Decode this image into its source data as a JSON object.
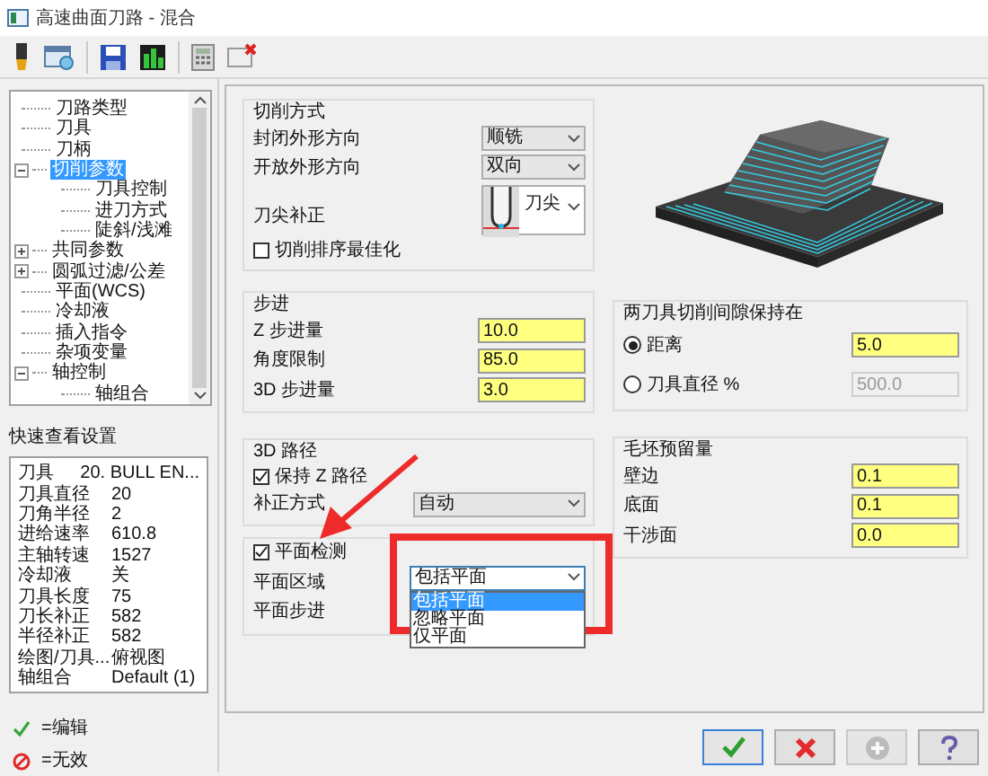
{
  "window": {
    "title": "高速曲面刀路 - 混合"
  },
  "tree": [
    {
      "label": "刀路类型",
      "selected": false
    },
    {
      "label": "刀具",
      "selected": false
    },
    {
      "label": "刀柄",
      "selected": false
    },
    {
      "label": "切削参数",
      "selected": true,
      "expanded": true,
      "children": [
        {
          "label": "刀具控制",
          "selected": false
        },
        {
          "label": "进刀方式",
          "selected": false
        },
        {
          "label": "陡斜/浅滩",
          "selected": false
        }
      ]
    },
    {
      "label": "共同参数",
      "selected": false,
      "expanded": false
    },
    {
      "label": "圆弧过滤/公差",
      "selected": false,
      "expanded": false
    },
    {
      "label": "平面(WCS)",
      "selected": false
    },
    {
      "label": "冷却液",
      "selected": false
    },
    {
      "label": "插入指令",
      "selected": false
    },
    {
      "label": "杂项变量",
      "selected": false
    },
    {
      "label": "轴控制",
      "selected": false,
      "expanded": true,
      "children": [
        {
          "label": "轴组合",
          "selected": false
        }
      ]
    }
  ],
  "quick_view": {
    "title": "快速查看设置",
    "rows": [
      {
        "label": "刀具",
        "value": "20. BULL EN..."
      },
      {
        "label": "刀具直径",
        "value": "20"
      },
      {
        "label": "刀角半径",
        "value": "2"
      },
      {
        "label": "进给速率",
        "value": "610.8"
      },
      {
        "label": "主轴转速",
        "value": "1527"
      },
      {
        "label": "冷却液",
        "value": "关"
      },
      {
        "label": "刀具长度",
        "value": "75"
      },
      {
        "label": "刀长补正",
        "value": "582"
      },
      {
        "label": "半径补正",
        "value": "582"
      },
      {
        "label": "绘图/刀具...",
        "value": "俯视图"
      },
      {
        "label": "轴组合",
        "value": "Default (1)"
      }
    ]
  },
  "legend": [
    {
      "kind": "edit",
      "text": "=编辑"
    },
    {
      "kind": "invalid",
      "text": "=无效"
    }
  ],
  "cut_method": {
    "title": "切削方式",
    "fields": [
      {
        "kind": "select",
        "label": "封闭外形方向",
        "value": "顺铣"
      },
      {
        "kind": "select",
        "label": "开放外形方向",
        "value": "双向"
      },
      {
        "kind": "tool",
        "label": "刀尖补正",
        "value": "刀尖"
      },
      {
        "kind": "checkbox",
        "label": "切削排序最佳化",
        "checked": false
      }
    ]
  },
  "stepdown": {
    "title": "步进",
    "fields": [
      {
        "kind": "input",
        "label": "Z 步进量",
        "value": "10.0"
      },
      {
        "kind": "input",
        "label": "角度限制",
        "value": "85.0"
      },
      {
        "kind": "input",
        "label": "3D 步进量",
        "value": "3.0"
      }
    ]
  },
  "path_3d": {
    "title": "3D 路径",
    "fields": [
      {
        "kind": "checkbox",
        "label": "保持 Z 路径",
        "checked": true
      },
      {
        "kind": "select",
        "label": "补正方式",
        "value": "自动"
      }
    ]
  },
  "flat_detect": {
    "label": "平面检测",
    "checked": true,
    "fields": [
      {
        "kind": "open_select",
        "label": "平面区域",
        "value": "包括平面",
        "options": [
          {
            "label": "包括平面",
            "selected": true
          },
          {
            "label": "忽略平面",
            "selected": false
          },
          {
            "label": "仅平面",
            "selected": false
          }
        ]
      },
      {
        "kind": "label",
        "label": "平面步进"
      }
    ]
  },
  "clearance": {
    "title": "两刀具切削间隙保持在",
    "fields": [
      {
        "kind": "radio",
        "label": "距离",
        "selected": true,
        "value": "5.0"
      },
      {
        "kind": "radio",
        "label": "刀具直径 %",
        "selected": false,
        "value": "500.0"
      }
    ]
  },
  "stock": {
    "title": "毛坯预留量",
    "fields": [
      {
        "kind": "input",
        "label": "壁边",
        "value": "0.1"
      },
      {
        "kind": "input",
        "label": "底面",
        "value": "0.1"
      },
      {
        "kind": "input",
        "label": "干涉面",
        "value": "0.0"
      }
    ]
  },
  "buttons": [
    {
      "kind": "ok",
      "disabled": false
    },
    {
      "kind": "cancel",
      "disabled": false
    },
    {
      "kind": "add",
      "disabled": true
    },
    {
      "kind": "help",
      "disabled": false
    }
  ]
}
